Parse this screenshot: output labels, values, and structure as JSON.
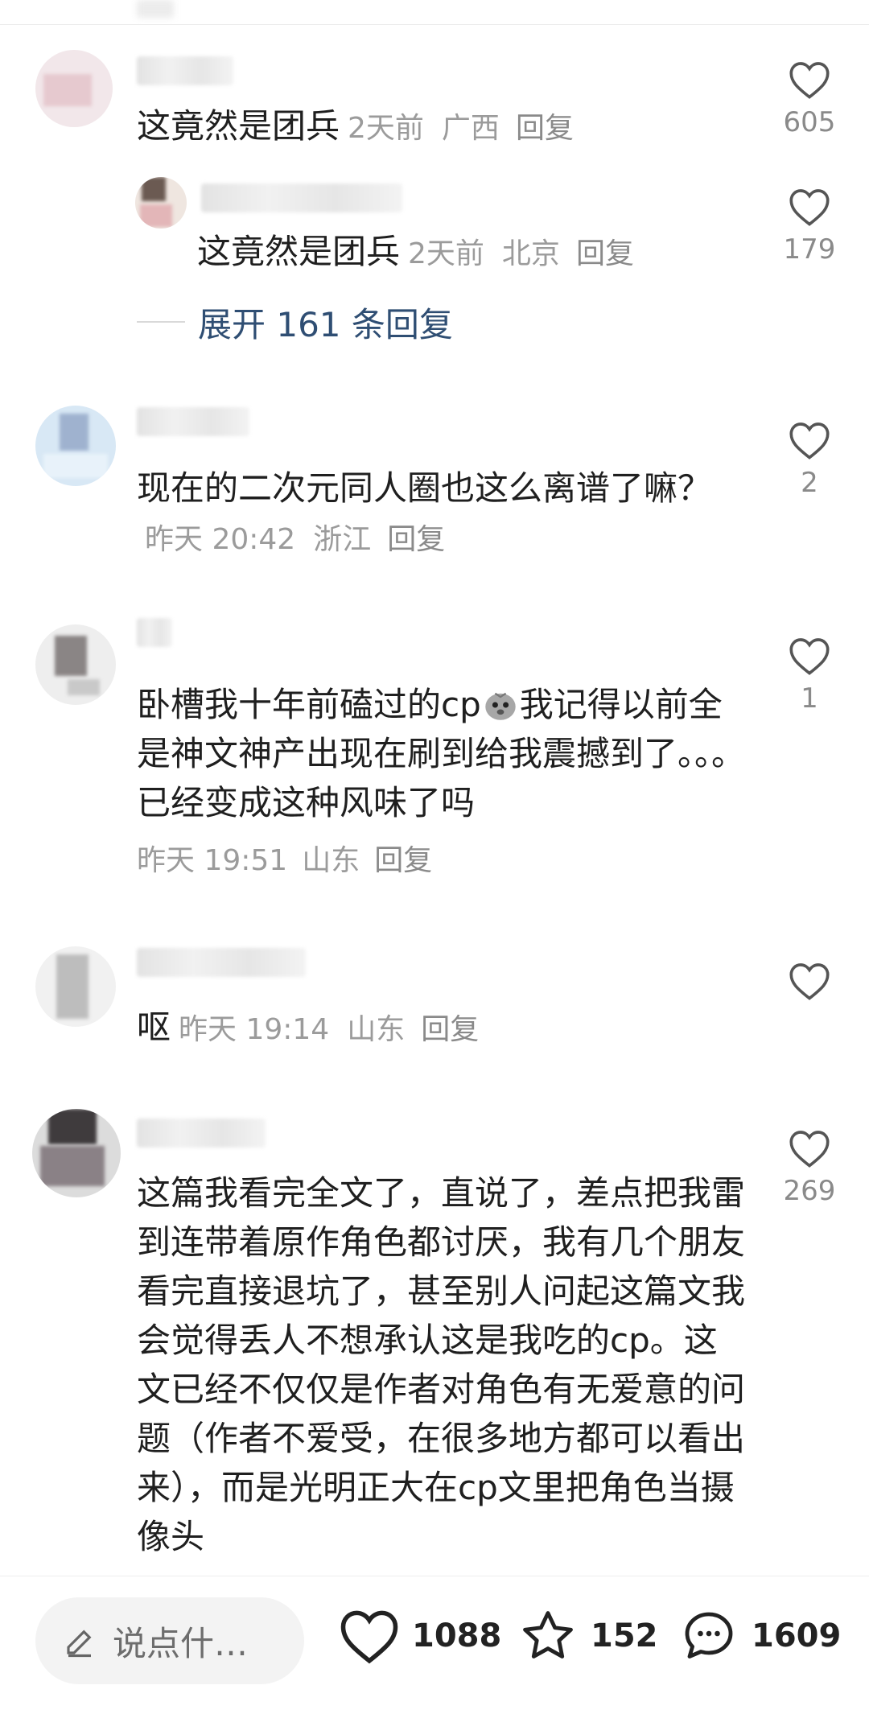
{
  "comments": [
    {
      "text": "这竟然是团兵",
      "time": "2天前",
      "location": "广西",
      "reply": "回复",
      "likes": "605"
    },
    {
      "text": "这竟然是团兵",
      "time": "2天前",
      "location": "北京",
      "reply": "回复",
      "likes": "179"
    },
    {
      "text": "现在的二次元同人圈也这么离谱了嘛？",
      "time": "昨天 20:42",
      "location": "浙江",
      "reply": "回复",
      "likes": "2"
    },
    {
      "text_a": "卧槽我十年前磕过的cp",
      "text_b": "我记得以前全是神文神产出现在刷到给我震撼到了。。。已经变成这种风味了吗",
      "time": "昨天 19:51",
      "location": "山东",
      "reply": "回复",
      "likes": "1"
    },
    {
      "text": "呕",
      "time": "昨天 19:14",
      "location": "山东",
      "reply": "回复",
      "likes": ""
    },
    {
      "text": "这篇我看完全文了，直说了，差点把我雷到连带着原作角色都讨厌，我有几个朋友看完直接退坑了，甚至别人问起这篇文我会觉得丢人不想承认这是我吃的cp。这文已经不仅仅是作者对角色有无爱意的问题（作者不爱受，在很多地方都可以看出来），而是光明正大在cp文里把角色当摄像头",
      "likes": "269"
    }
  ],
  "expand_replies": "展开 161 条回复",
  "bottom_bar": {
    "input_placeholder": "说点什…",
    "likes": "1088",
    "favorites": "152",
    "comments": "1609"
  },
  "colors": {
    "accent_link": "#2f4e73",
    "meta_gray": "#9b9b9b"
  },
  "icons": [
    "heart-icon",
    "sad-face-emoji",
    "pencil-icon",
    "star-icon",
    "chat-bubble-icon"
  ]
}
